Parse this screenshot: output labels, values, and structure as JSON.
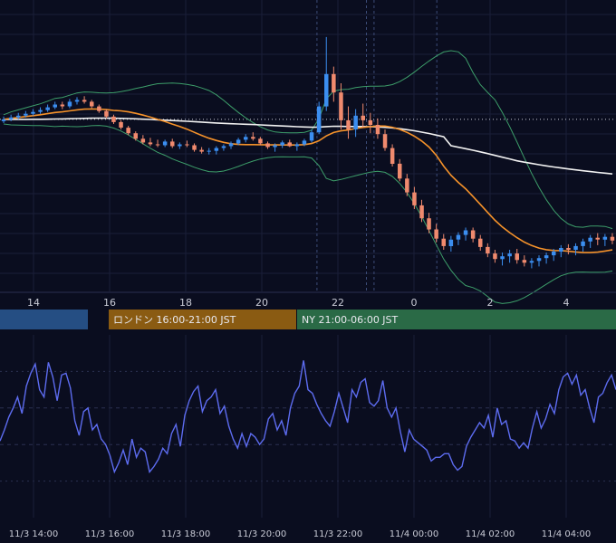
{
  "chart_data": {
    "type": "candlestick",
    "price_panel": {
      "x_ticks": [
        "14",
        "16",
        "18",
        "20",
        "22",
        "0",
        "2",
        "4"
      ],
      "candles": [
        {
          "o": 0.29,
          "h": 0.34,
          "l": 0.27,
          "c": 0.31
        },
        {
          "o": 0.31,
          "h": 0.36,
          "l": 0.29,
          "c": 0.33
        },
        {
          "o": 0.33,
          "h": 0.38,
          "l": 0.31,
          "c": 0.35
        },
        {
          "o": 0.35,
          "h": 0.4,
          "l": 0.33,
          "c": 0.37
        },
        {
          "o": 0.37,
          "h": 0.42,
          "l": 0.35,
          "c": 0.39
        },
        {
          "o": 0.39,
          "h": 0.44,
          "l": 0.37,
          "c": 0.41
        },
        {
          "o": 0.41,
          "h": 0.47,
          "l": 0.39,
          "c": 0.44
        },
        {
          "o": 0.44,
          "h": 0.5,
          "l": 0.42,
          "c": 0.47
        },
        {
          "o": 0.47,
          "h": 0.5,
          "l": 0.42,
          "c": 0.45
        },
        {
          "o": 0.45,
          "h": 0.53,
          "l": 0.43,
          "c": 0.5
        },
        {
          "o": 0.5,
          "h": 0.55,
          "l": 0.47,
          "c": 0.52
        },
        {
          "o": 0.52,
          "h": 0.56,
          "l": 0.48,
          "c": 0.5
        },
        {
          "o": 0.5,
          "h": 0.52,
          "l": 0.43,
          "c": 0.45
        },
        {
          "o": 0.45,
          "h": 0.47,
          "l": 0.38,
          "c": 0.4
        },
        {
          "o": 0.4,
          "h": 0.42,
          "l": 0.32,
          "c": 0.34
        },
        {
          "o": 0.34,
          "h": 0.36,
          "l": 0.26,
          "c": 0.28
        },
        {
          "o": 0.28,
          "h": 0.3,
          "l": 0.2,
          "c": 0.22
        },
        {
          "o": 0.22,
          "h": 0.24,
          "l": 0.14,
          "c": 0.16
        },
        {
          "o": 0.16,
          "h": 0.18,
          "l": 0.08,
          "c": 0.1
        },
        {
          "o": 0.1,
          "h": 0.14,
          "l": 0.04,
          "c": 0.06
        },
        {
          "o": 0.06,
          "h": 0.11,
          "l": 0.02,
          "c": 0.04
        },
        {
          "o": 0.04,
          "h": 0.09,
          "l": 0.01,
          "c": 0.03
        },
        {
          "o": 0.03,
          "h": 0.09,
          "l": 0.01,
          "c": 0.07
        },
        {
          "o": 0.07,
          "h": 0.1,
          "l": 0.0,
          "c": 0.02
        },
        {
          "o": 0.02,
          "h": 0.06,
          "l": -0.01,
          "c": 0.04
        },
        {
          "o": 0.04,
          "h": 0.08,
          "l": 0.01,
          "c": 0.03
        },
        {
          "o": 0.03,
          "h": 0.05,
          "l": -0.04,
          "c": -0.02
        },
        {
          "o": -0.02,
          "h": 0.01,
          "l": -0.06,
          "c": -0.04
        },
        {
          "o": -0.04,
          "h": 0.0,
          "l": -0.07,
          "c": -0.03
        },
        {
          "o": -0.03,
          "h": 0.02,
          "l": -0.07,
          "c": 0.0
        },
        {
          "o": 0.0,
          "h": 0.04,
          "l": -0.03,
          "c": 0.02
        },
        {
          "o": 0.02,
          "h": 0.07,
          "l": -0.01,
          "c": 0.05
        },
        {
          "o": 0.05,
          "h": 0.11,
          "l": 0.03,
          "c": 0.09
        },
        {
          "o": 0.09,
          "h": 0.15,
          "l": 0.06,
          "c": 0.12
        },
        {
          "o": 0.12,
          "h": 0.17,
          "l": 0.08,
          "c": 0.1
        },
        {
          "o": 0.1,
          "h": 0.12,
          "l": 0.03,
          "c": 0.05
        },
        {
          "o": 0.05,
          "h": 0.07,
          "l": -0.01,
          "c": 0.01
        },
        {
          "o": 0.01,
          "h": 0.05,
          "l": -0.04,
          "c": 0.03
        },
        {
          "o": 0.03,
          "h": 0.08,
          "l": 0.0,
          "c": 0.06
        },
        {
          "o": 0.06,
          "h": 0.09,
          "l": 0.01,
          "c": 0.02
        },
        {
          "o": 0.02,
          "h": 0.06,
          "l": -0.03,
          "c": 0.04
        },
        {
          "o": 0.04,
          "h": 0.1,
          "l": 0.02,
          "c": 0.08
        },
        {
          "o": 0.08,
          "h": 0.2,
          "l": 0.06,
          "c": 0.17
        },
        {
          "o": 0.17,
          "h": 0.5,
          "l": 0.15,
          "c": 0.45
        },
        {
          "o": 0.45,
          "h": 1.2,
          "l": 0.4,
          "c": 0.8
        },
        {
          "o": 0.8,
          "h": 0.88,
          "l": 0.5,
          "c": 0.6
        },
        {
          "o": 0.6,
          "h": 0.7,
          "l": 0.2,
          "c": 0.3
        },
        {
          "o": 0.3,
          "h": 0.45,
          "l": 0.1,
          "c": 0.2
        },
        {
          "o": 0.2,
          "h": 0.42,
          "l": 0.12,
          "c": 0.35
        },
        {
          "o": 0.35,
          "h": 0.48,
          "l": 0.22,
          "c": 0.3
        },
        {
          "o": 0.3,
          "h": 0.38,
          "l": 0.16,
          "c": 0.25
        },
        {
          "o": 0.25,
          "h": 0.32,
          "l": 0.1,
          "c": 0.15
        },
        {
          "o": 0.15,
          "h": 0.2,
          "l": -0.03,
          "c": 0.0
        },
        {
          "o": 0.0,
          "h": 0.04,
          "l": -0.2,
          "c": -0.17
        },
        {
          "o": -0.17,
          "h": -0.12,
          "l": -0.36,
          "c": -0.33
        },
        {
          "o": -0.33,
          "h": -0.28,
          "l": -0.52,
          "c": -0.48
        },
        {
          "o": -0.48,
          "h": -0.42,
          "l": -0.66,
          "c": -0.62
        },
        {
          "o": -0.62,
          "h": -0.56,
          "l": -0.8,
          "c": -0.76
        },
        {
          "o": -0.76,
          "h": -0.7,
          "l": -0.92,
          "c": -0.88
        },
        {
          "o": -0.88,
          "h": -0.82,
          "l": -1.02,
          "c": -0.98
        },
        {
          "o": -0.98,
          "h": -0.93,
          "l": -1.1,
          "c": -1.06
        },
        {
          "o": -1.06,
          "h": -0.95,
          "l": -1.12,
          "c": -0.99
        },
        {
          "o": -0.99,
          "h": -0.91,
          "l": -1.05,
          "c": -0.94
        },
        {
          "o": -0.94,
          "h": -0.86,
          "l": -1.0,
          "c": -0.89
        },
        {
          "o": -0.89,
          "h": -0.86,
          "l": -1.02,
          "c": -0.98
        },
        {
          "o": -0.98,
          "h": -0.94,
          "l": -1.11,
          "c": -1.07
        },
        {
          "o": -1.07,
          "h": -1.03,
          "l": -1.18,
          "c": -1.14
        },
        {
          "o": -1.14,
          "h": -1.1,
          "l": -1.24,
          "c": -1.2
        },
        {
          "o": -1.2,
          "h": -1.13,
          "l": -1.27,
          "c": -1.17
        },
        {
          "o": -1.17,
          "h": -1.1,
          "l": -1.24,
          "c": -1.14
        },
        {
          "o": -1.14,
          "h": -1.09,
          "l": -1.25,
          "c": -1.21
        },
        {
          "o": -1.21,
          "h": -1.16,
          "l": -1.28,
          "c": -1.24
        },
        {
          "o": -1.24,
          "h": -1.19,
          "l": -1.3,
          "c": -1.22
        },
        {
          "o": -1.22,
          "h": -1.16,
          "l": -1.28,
          "c": -1.19
        },
        {
          "o": -1.19,
          "h": -1.13,
          "l": -1.25,
          "c": -1.16
        },
        {
          "o": -1.16,
          "h": -1.09,
          "l": -1.22,
          "c": -1.12
        },
        {
          "o": -1.12,
          "h": -1.05,
          "l": -1.18,
          "c": -1.08
        },
        {
          "o": -1.08,
          "h": -1.04,
          "l": -1.15,
          "c": -1.1
        },
        {
          "o": -1.1,
          "h": -1.03,
          "l": -1.16,
          "c": -1.06
        },
        {
          "o": -1.06,
          "h": -0.98,
          "l": -1.12,
          "c": -1.01
        },
        {
          "o": -1.01,
          "h": -0.94,
          "l": -1.08,
          "c": -0.97
        },
        {
          "o": -0.97,
          "h": -0.92,
          "l": -1.05,
          "c": -0.99
        },
        {
          "o": -0.99,
          "h": -0.93,
          "l": -1.06,
          "c": -0.96
        },
        {
          "o": -0.96,
          "h": -0.92,
          "l": -1.04,
          "c": -1.0
        }
      ],
      "reference_line_level": 0.31,
      "session_markers_hours": [
        21.45,
        22.75,
        22.95,
        0.6
      ],
      "moving_average_colors": {
        "fast": "#f5922a",
        "slow": "#f2f2f2"
      },
      "bollinger_color": "#3d9e6a",
      "up_color": "#3b8ef0",
      "down_color": "#f08a6e"
    },
    "sessions": [
      {
        "label": "",
        "color": "#254e83"
      },
      {
        "label": "ロンドン 16:00-21:00 JST",
        "color": "#8a5b12"
      },
      {
        "label": "NY 21:00-06:00 JST",
        "color": "#2a6a46"
      }
    ],
    "oscillator_panel": {
      "x_ticks": [
        "11/3 14:00",
        "11/3 16:00",
        "11/3 18:00",
        "11/3 20:00",
        "11/3 22:00",
        "11/4 00:00",
        "11/4 02:00",
        "11/4 04:00"
      ],
      "ylim": [
        0,
        100
      ],
      "values": [
        42,
        48,
        55,
        60,
        66,
        57,
        72,
        79,
        84,
        70,
        66,
        85,
        77,
        64,
        78,
        79,
        71,
        53,
        45,
        58,
        60,
        48,
        51,
        43,
        40,
        34,
        25,
        30,
        37,
        29,
        43,
        33,
        38,
        36,
        25,
        28,
        32,
        38,
        35,
        46,
        51,
        39,
        56,
        64,
        69,
        72,
        58,
        64,
        66,
        70,
        57,
        61,
        50,
        43,
        38,
        46,
        39,
        46,
        44,
        40,
        43,
        54,
        57,
        48,
        53,
        45,
        60,
        68,
        72,
        86,
        70,
        68,
        62,
        57,
        53,
        50,
        58,
        68,
        60,
        52,
        70,
        66,
        74,
        76,
        63,
        61,
        64,
        75,
        60,
        55,
        60,
        47,
        36,
        48,
        43,
        41,
        39,
        37,
        31,
        33,
        33,
        35,
        35,
        29,
        26,
        28,
        39,
        44,
        48,
        52,
        49,
        56,
        44,
        60,
        51,
        53,
        43,
        42,
        38,
        41,
        38,
        49,
        58,
        49,
        54,
        62,
        57,
        70,
        77,
        79,
        73,
        78,
        67,
        70,
        60,
        52,
        66,
        68,
        74,
        78,
        70
      ]
    }
  }
}
